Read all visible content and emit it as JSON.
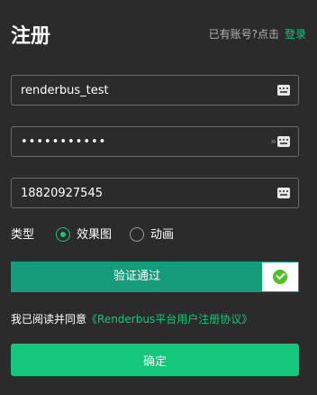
{
  "header": {
    "title": "注册",
    "login_prompt": "已有账号?点击",
    "login_link": "登录"
  },
  "form": {
    "username": {
      "value": "renderbus_test",
      "icon": "keyboard-icon"
    },
    "password": {
      "value": "•••••••••••",
      "toggle_icon": "eye-off-icon",
      "icon": "keyboard-icon"
    },
    "phone": {
      "value": "18820927545",
      "icon": "keyboard-icon"
    }
  },
  "type": {
    "label": "类型",
    "options": [
      {
        "label": "效果图",
        "selected": true
      },
      {
        "label": "动画",
        "selected": false
      }
    ]
  },
  "verify": {
    "label": "验证通过",
    "status_icon": "check-circle-icon",
    "bar_color": "#169b7b",
    "check_color": "#4fbf2a"
  },
  "agreement": {
    "text": "我已阅读并同意",
    "link": "《Renderbus平台用户注册协议》"
  },
  "submit": {
    "label": "确定"
  },
  "colors": {
    "background": "#2b2b2b",
    "accent": "#14c77a",
    "link": "#18c47b",
    "border": "#6b6b6b"
  }
}
